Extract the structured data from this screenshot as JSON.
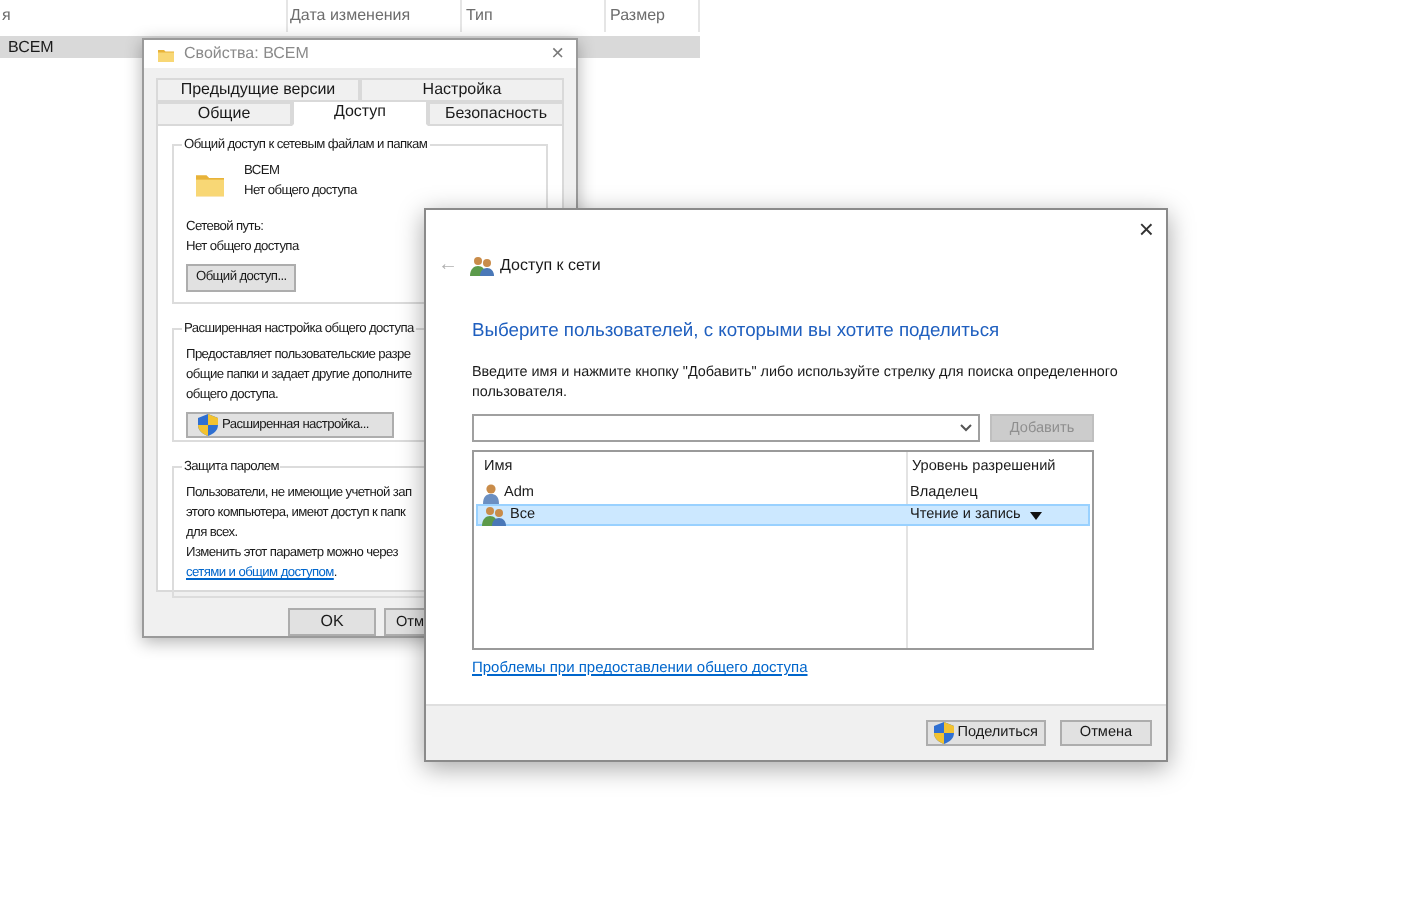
{
  "explorer": {
    "columns": [
      "я",
      "Дата изменения",
      "Тип",
      "Размер"
    ],
    "rows": [
      {
        "name": "ВСЕМ",
        "selected": true
      }
    ]
  },
  "properties": {
    "title": "Свойства: ВСЕМ",
    "close_glyph": "×",
    "tab_rows": [
      [
        {
          "label": "Предыдущие версии",
          "selected": false
        },
        {
          "label": "Настройка",
          "selected": false
        }
      ],
      [
        {
          "label": "Общие",
          "selected": false
        },
        {
          "label": "Доступ",
          "selected": true
        },
        {
          "label": "Безопасность",
          "selected": false
        }
      ]
    ],
    "sharing_group": {
      "title": "Общий доступ к сетевым файлам и папкам",
      "folder_name": "ВСЕМ",
      "folder_status": "Нет общего доступа",
      "path_label": "Сетевой путь:",
      "path_value": "Нет общего доступа",
      "button": "Общий доступ..."
    },
    "advanced_group": {
      "title": "Расширенная настройка общего доступа",
      "text": [
        "Предоставляет пользовательские разре",
        "общие папки и задает другие дополните",
        "общего доступа."
      ],
      "button": "Расширенная настройка..."
    },
    "password_group": {
      "title": "Защита паролем",
      "text": [
        "Пользователи, не имеющие учетной зап",
        "этого компьютера, имеют доступ к папк",
        "для всех.",
        "Изменить этот параметр можно через"
      ],
      "link": "сетями и общим доступом",
      "after_link": "."
    },
    "buttons": [
      "OK",
      "Отм"
    ]
  },
  "dialog": {
    "close_glyph": "×",
    "back_glyph": "←",
    "title": "Доступ к сети",
    "heading": "Выберите пользователей, с которыми вы хотите поделиться",
    "instruction": [
      "Введите имя и нажмите кнопку \"Добавить\" либо используйте стрелку для поиска определенного",
      "пользователя."
    ],
    "add_button": {
      "label": "Добавить",
      "disabled": true
    },
    "columns": [
      "Имя",
      "Уровень разрешений"
    ],
    "users": [
      {
        "name": "Adm",
        "kind": "user",
        "permission": "Владелец",
        "dropdown": false,
        "selected": false
      },
      {
        "name": "Все",
        "kind": "group",
        "permission": "Чтение и запись",
        "dropdown": true,
        "selected": true
      }
    ],
    "link": "Проблемы при предоставлении общего доступа",
    "buttons": [
      {
        "label": "Поделиться",
        "kind": "shield"
      },
      {
        "label": "Отмена",
        "kind": "plain"
      }
    ]
  }
}
